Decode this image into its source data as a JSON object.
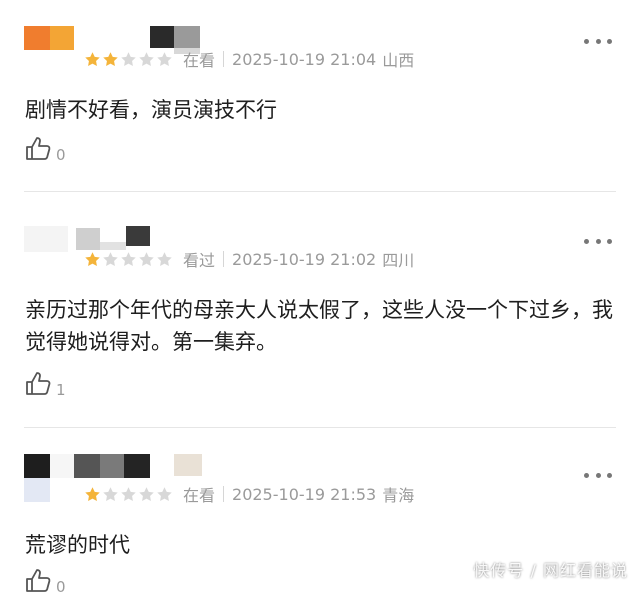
{
  "colors": {
    "star_filled": "#f4b43a",
    "star_empty": "#d8d8d8",
    "meta_text": "#9a9a9a",
    "divider": "#e6e6e6"
  },
  "icons": {
    "star": "star-icon",
    "like": "thumbs-up-icon",
    "more": "more-dots-icon"
  },
  "reviews": [
    {
      "rating": 2,
      "max_rating": 5,
      "status": "在看",
      "time": "2025-10-19 21:04",
      "region": "山西",
      "content": "剧情不好看，演员演技不行",
      "likes": "0"
    },
    {
      "rating": 1,
      "max_rating": 5,
      "status": "看过",
      "time": "2025-10-19 21:02",
      "region": "四川",
      "content": "亲历过那个年代的母亲大人说太假了，这些人没一个下过乡，我觉得她说得对。第一集弃。",
      "likes": "1"
    },
    {
      "rating": 1,
      "max_rating": 5,
      "status": "在看",
      "time": "2025-10-19 21:53",
      "region": "青海",
      "content": "荒谬的时代",
      "likes": "0"
    }
  ],
  "watermark": "快传号 / 网红看能说"
}
